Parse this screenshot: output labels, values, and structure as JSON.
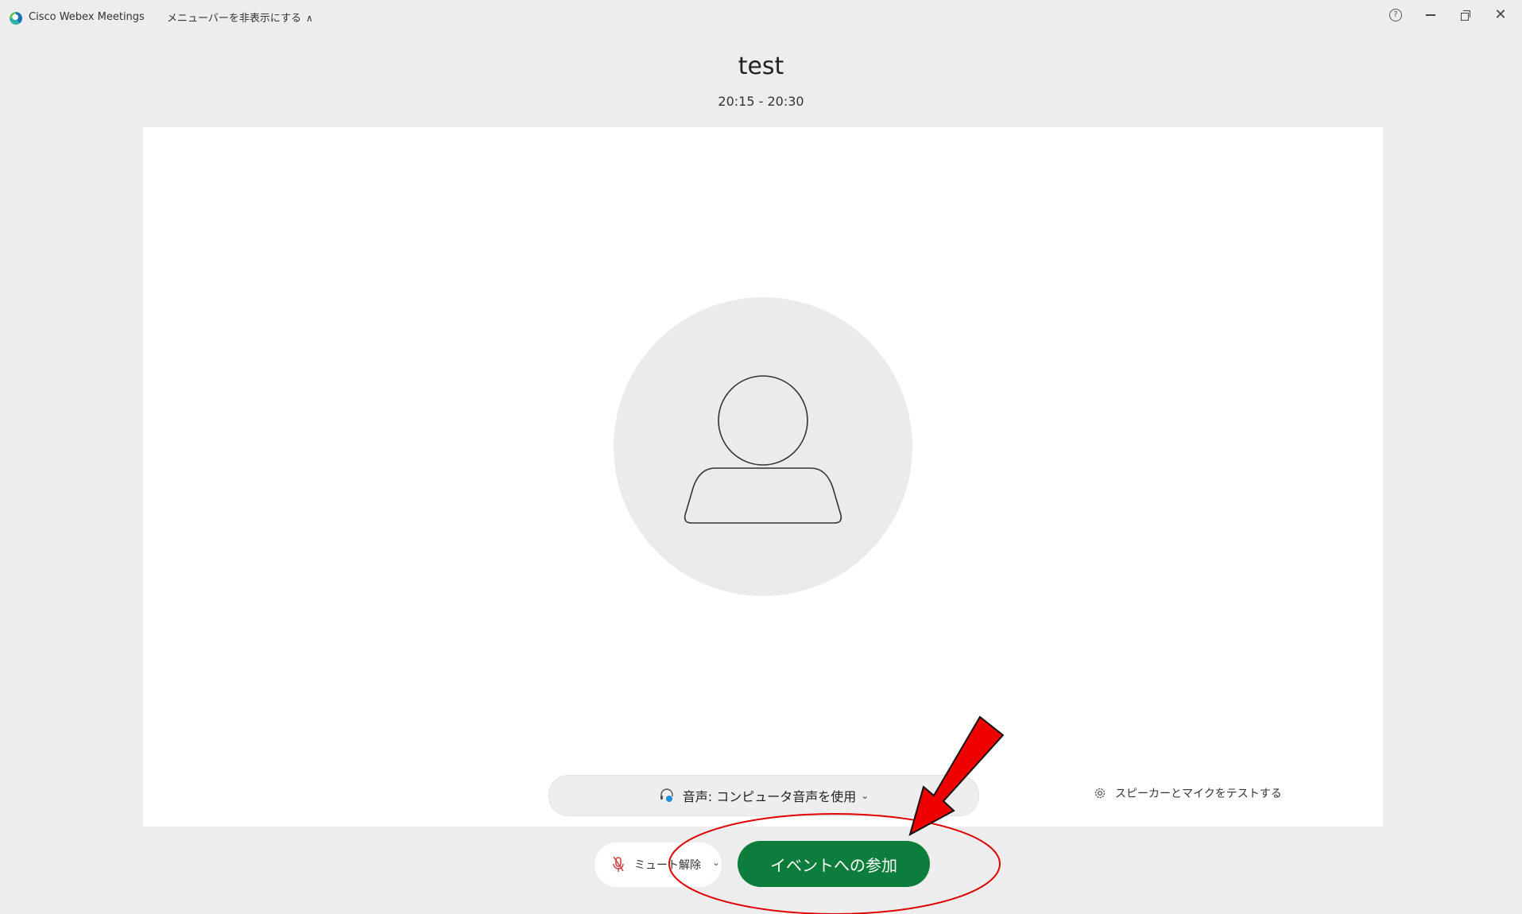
{
  "titlebar": {
    "app_name": "Cisco Webex Meetings",
    "menu_toggle": "メニューバーを非表示にする",
    "menu_toggle_chevron": "∧",
    "help_glyph": "?",
    "close_glyph": "✕"
  },
  "meeting": {
    "title": "test",
    "time": "20:15 - 20:30"
  },
  "audio": {
    "label": "音声: コンピュータ音声を使用",
    "chevron": "⌄"
  },
  "test_audio": {
    "label": "スピーカーとマイクをテストする"
  },
  "mute": {
    "label": "ミュート解除",
    "chevron": "⌄"
  },
  "join": {
    "label": "イベントへの参加"
  },
  "colors": {
    "join_green": "#0c7d3a",
    "annotation_red": "#e00000",
    "background": "#ededed"
  },
  "icons": {
    "app_logo": "webex-logo-icon",
    "help": "help-icon",
    "minimize": "minimize-icon",
    "restore": "restore-icon",
    "close": "close-icon",
    "avatar": "person-icon",
    "headset": "headset-icon",
    "gear": "gear-icon",
    "mic": "mic-muted-icon",
    "annotation_arrow": "red-arrow-icon"
  }
}
